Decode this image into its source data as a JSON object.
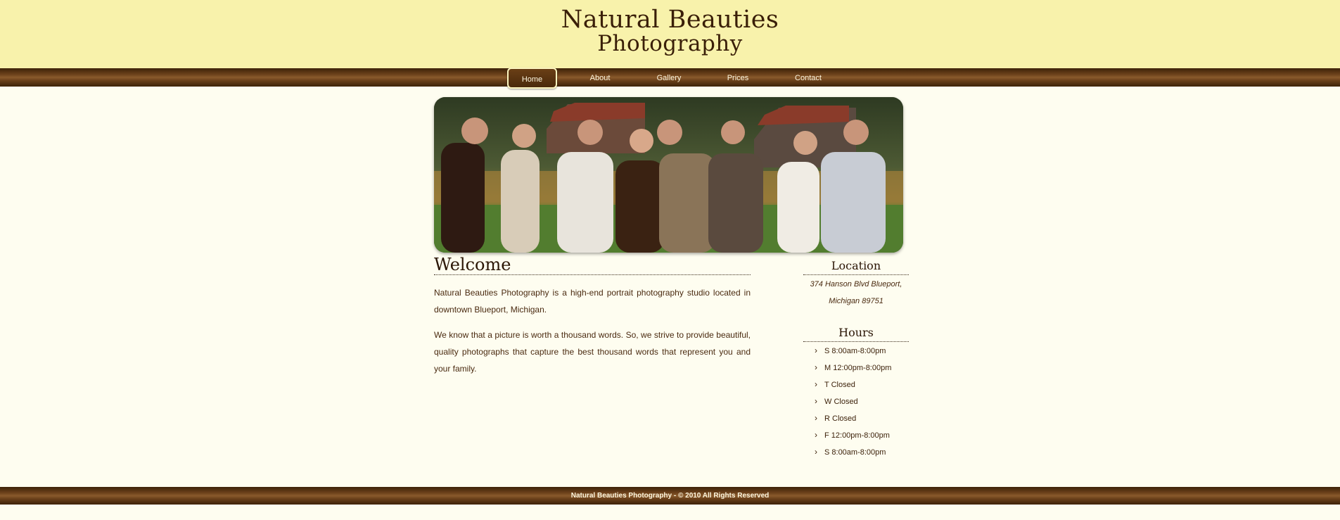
{
  "site": {
    "logo_line1": "Natural Beauties",
    "logo_line2": "Photography"
  },
  "nav": {
    "items": [
      {
        "label": "Home",
        "active": true
      },
      {
        "label": "About",
        "active": false
      },
      {
        "label": "Gallery",
        "active": false
      },
      {
        "label": "Prices",
        "active": false
      },
      {
        "label": "Contact",
        "active": false
      }
    ]
  },
  "main": {
    "heading": "Welcome",
    "paragraphs": [
      "Natural Beauties Photography is a high-end portrait photography studio located in downtown Blueport, Michigan.",
      "We know that a picture is worth a thousand words. So, we strive to provide beautiful, quality photographs that capture the best thousand words that represent you and your family."
    ]
  },
  "sidebar": {
    "location_heading": "Location",
    "address_line1": "374 Hanson Blvd Blueport,",
    "address_line2": "Michigan 89751",
    "hours_heading": "Hours",
    "hours": [
      "S 8:00am-8:00pm",
      "M 12:00pm-8:00pm",
      "T Closed",
      "W Closed",
      "R Closed",
      "F 12:00pm-8:00pm",
      "S 8:00am-8:00pm"
    ]
  },
  "footer": {
    "text": "Natural Beauties Photography - © 2010 All Rights Reserved"
  },
  "colors": {
    "header_bg": "#f8f2ab",
    "page_bg": "#fefdf0",
    "brown_bar": "#6e431c",
    "text": "#4a2a10"
  },
  "icons": {
    "list_bullet": "chevron-right-icon"
  }
}
